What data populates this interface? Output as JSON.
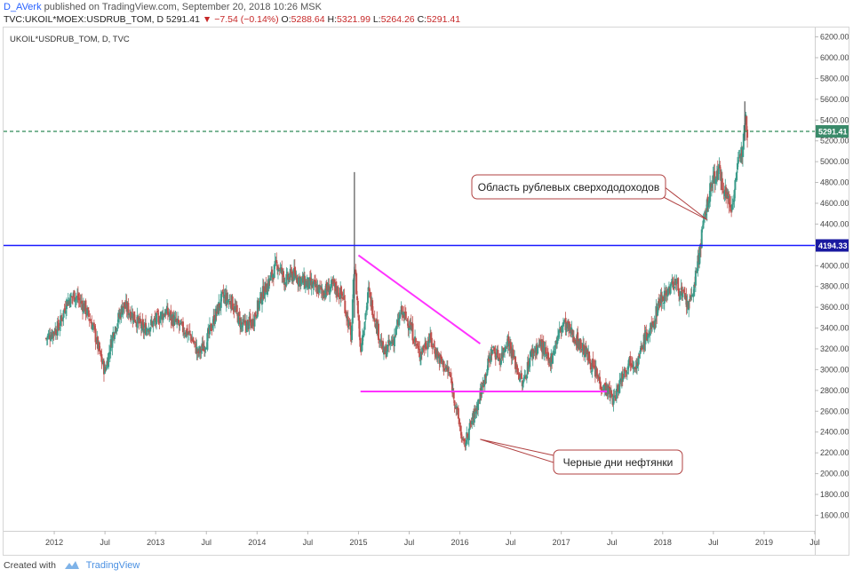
{
  "header": {
    "author": "D_AVerk",
    "published": "published on TradingView.com, September 20, 2018 10:26 MSK",
    "symbol": "TVC:UKOIL*MOEX:USDRUB_TOM, D",
    "last": "5291.41",
    "change": "−7.54 (−0.14%)",
    "open_label": "O:",
    "open": "5288.64",
    "high_label": "H:",
    "high": "5321.99",
    "low_label": "L:",
    "low": "5264.26",
    "close_label": "C:",
    "close": "5291.41"
  },
  "footer": {
    "created_with": "Created with",
    "brand": "TradingView",
    "logo_icon": "tradingview-logo-icon"
  },
  "colors": {
    "up": "#3a9b8a",
    "down": "#c0504d",
    "hline": "#1a1aff",
    "trend": "#ff33ff",
    "dashed": "#2e8b57",
    "annotation_border": "#b04040"
  },
  "chart_data": {
    "type": "candlestick",
    "legend": "UKOIL*USDRUB_TOM, D, TVC",
    "x_tick_labels": [
      "2012",
      "Jul",
      "2013",
      "Jul",
      "2014",
      "Jul",
      "2015",
      "Jul",
      "2016",
      "Jul",
      "2017",
      "Jul",
      "2018",
      "Jul",
      "2019",
      "Jul"
    ],
    "x_ticks": [
      2012.0,
      2012.5,
      2013.0,
      2013.5,
      2014.0,
      2014.5,
      2015.0,
      2015.5,
      2016.0,
      2016.5,
      2017.0,
      2017.5,
      2018.0,
      2018.5,
      2019.0,
      2019.5
    ],
    "xlim": [
      2011.5,
      2019.5
    ],
    "ylim": [
      1450,
      6290
    ],
    "y_ticks": [
      1600,
      1800,
      2000,
      2200,
      2400,
      2600,
      2800,
      3000,
      3200,
      3400,
      3600,
      3800,
      4000,
      4200,
      4400,
      4600,
      4800,
      5000,
      5200,
      5400,
      5600,
      5800,
      6000,
      6200
    ],
    "y_tick_labels": [
      "1600.00",
      "1800.00",
      "2000.00",
      "2200.00",
      "2400.00",
      "2600.00",
      "2800.00",
      "3000.00",
      "3200.00",
      "3400.00",
      "3600.00",
      "3800.00",
      "4000.00",
      "4200.00",
      "4400.00",
      "4600.00",
      "4800.00",
      "5000.00",
      "5200.00",
      "5400.00",
      "5600.00",
      "5800.00",
      "6000.00",
      "6200.00"
    ],
    "price_path": [
      [
        2011.92,
        3300
      ],
      [
        2012.05,
        3420
      ],
      [
        2012.12,
        3650
      ],
      [
        2012.2,
        3720
      ],
      [
        2012.3,
        3600
      ],
      [
        2012.38,
        3420
      ],
      [
        2012.45,
        3150
      ],
      [
        2012.5,
        2980
      ],
      [
        2012.58,
        3350
      ],
      [
        2012.68,
        3620
      ],
      [
        2012.78,
        3520
      ],
      [
        2012.88,
        3380
      ],
      [
        2013.0,
        3470
      ],
      [
        2013.1,
        3560
      ],
      [
        2013.2,
        3450
      ],
      [
        2013.28,
        3380
      ],
      [
        2013.35,
        3320
      ],
      [
        2013.42,
        3150
      ],
      [
        2013.5,
        3270
      ],
      [
        2013.58,
        3500
      ],
      [
        2013.66,
        3700
      ],
      [
        2013.75,
        3650
      ],
      [
        2013.85,
        3420
      ],
      [
        2013.95,
        3450
      ],
      [
        2014.05,
        3720
      ],
      [
        2014.12,
        3850
      ],
      [
        2014.2,
        4020
      ],
      [
        2014.28,
        3850
      ],
      [
        2014.35,
        3920
      ],
      [
        2014.45,
        3850
      ],
      [
        2014.55,
        3800
      ],
      [
        2014.65,
        3750
      ],
      [
        2014.75,
        3800
      ],
      [
        2014.85,
        3700
      ],
      [
        2014.93,
        3300
      ],
      [
        2014.96,
        4050
      ],
      [
        2015.02,
        3200
      ],
      [
        2015.1,
        3750
      ],
      [
        2015.16,
        3500
      ],
      [
        2015.25,
        3150
      ],
      [
        2015.35,
        3300
      ],
      [
        2015.42,
        3550
      ],
      [
        2015.5,
        3450
      ],
      [
        2015.6,
        3150
      ],
      [
        2015.7,
        3300
      ],
      [
        2015.8,
        3100
      ],
      [
        2015.9,
        2950
      ],
      [
        2015.97,
        2600
      ],
      [
        2016.04,
        2250
      ],
      [
        2016.1,
        2450
      ],
      [
        2016.17,
        2650
      ],
      [
        2016.25,
        2950
      ],
      [
        2016.32,
        3200
      ],
      [
        2016.4,
        3100
      ],
      [
        2016.47,
        3300
      ],
      [
        2016.55,
        3050
      ],
      [
        2016.62,
        2850
      ],
      [
        2016.7,
        3150
      ],
      [
        2016.8,
        3250
      ],
      [
        2016.88,
        3050
      ],
      [
        2016.96,
        3300
      ],
      [
        2017.02,
        3450
      ],
      [
        2017.1,
        3350
      ],
      [
        2017.18,
        3250
      ],
      [
        2017.25,
        3150
      ],
      [
        2017.32,
        3000
      ],
      [
        2017.4,
        2850
      ],
      [
        2017.46,
        2800
      ],
      [
        2017.52,
        2700
      ],
      [
        2017.6,
        2950
      ],
      [
        2017.68,
        3100
      ],
      [
        2017.75,
        3050
      ],
      [
        2017.82,
        3300
      ],
      [
        2017.9,
        3400
      ],
      [
        2017.96,
        3650
      ],
      [
        2018.04,
        3750
      ],
      [
        2018.12,
        3850
      ],
      [
        2018.2,
        3700
      ],
      [
        2018.26,
        3600
      ],
      [
        2018.32,
        3850
      ],
      [
        2018.38,
        4250
      ],
      [
        2018.44,
        4600
      ],
      [
        2018.5,
        4850
      ],
      [
        2018.56,
        4900
      ],
      [
        2018.62,
        4700
      ],
      [
        2018.68,
        4550
      ],
      [
        2018.72,
        4850
      ],
      [
        2018.78,
        5100
      ],
      [
        2018.81,
        5450
      ],
      [
        2018.84,
        5291
      ]
    ],
    "spike": {
      "x": 2014.96,
      "high": 4900,
      "low": 3500
    },
    "spike2": {
      "x": 2018.81,
      "high": 5580,
      "low": 5200
    },
    "horizontal_line": {
      "value": 4194.33,
      "label": "4194.33"
    },
    "last_price_line": {
      "value": 5291.41,
      "label": "5291.41"
    },
    "trendlines": [
      {
        "x1": 2015.0,
        "y1": 4100,
        "x2": 2016.2,
        "y2": 3250
      },
      {
        "x1": 2015.02,
        "y1": 2790,
        "x2": 2017.45,
        "y2": 2790
      }
    ],
    "annotations": [
      {
        "text": "Область рублевых сверхододоходов",
        "target_x": 2018.44,
        "target_y": 4440
      },
      {
        "text": "Черные дни нефтянки",
        "target_x": 2016.2,
        "target_y": 2330
      }
    ]
  }
}
